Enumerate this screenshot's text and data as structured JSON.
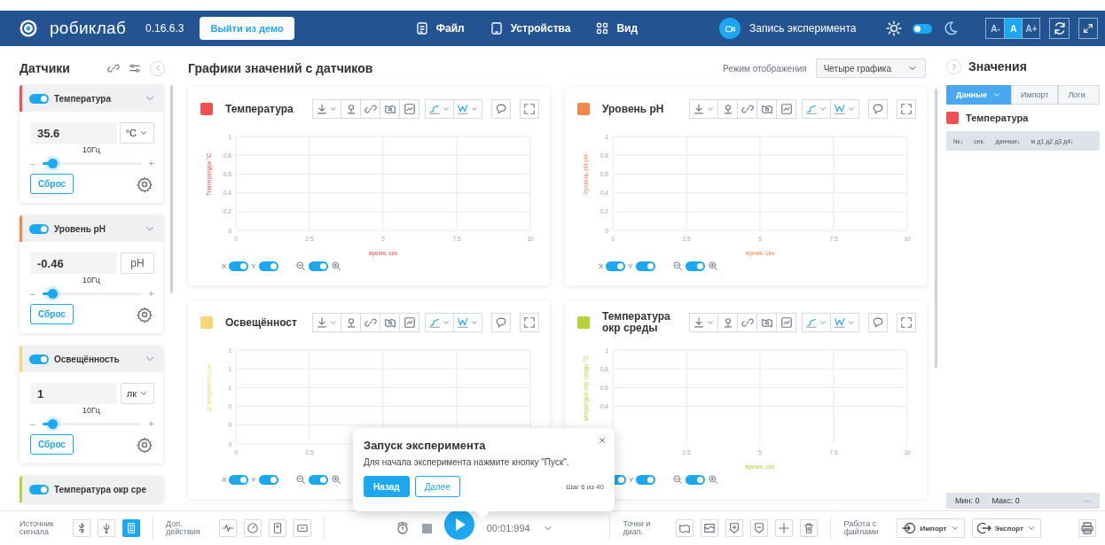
{
  "topbar": {
    "logo": "робиклаб",
    "version": "0.16.6.3",
    "demo_button": "Выйти из демо",
    "menu": [
      {
        "label": "Файл"
      },
      {
        "label": "Устройства"
      },
      {
        "label": "Вид"
      }
    ],
    "record": "Запись эксперимента",
    "dark_theme": false,
    "font_sizes": [
      {
        "label": "A-",
        "selected": false
      },
      {
        "label": "A",
        "selected": true
      },
      {
        "label": "A+",
        "selected": false
      }
    ]
  },
  "sidebar": {
    "title": "Датчики",
    "sensors": [
      {
        "kind": "full",
        "name": "Температура",
        "color": "#f05050",
        "enabled": true,
        "value": "35.6",
        "unit": "°C",
        "unit_dropdown": true,
        "rate": "10Гц",
        "minus": "–",
        "plus": "+",
        "level": 0.1,
        "reset": "Сброс"
      },
      {
        "kind": "full",
        "name": "Уровень pH",
        "color": "#f0884a",
        "enabled": true,
        "value": "-0.46",
        "unit": "pH",
        "unit_dropdown": false,
        "rate": "10Гц",
        "minus": "–",
        "plus": "+",
        "level": 0.1,
        "reset": "Сброс"
      },
      {
        "kind": "full",
        "name": "Освещённость",
        "color": "#f5d67a",
        "enabled": true,
        "value": "1",
        "unit": "лк",
        "unit_dropdown": true,
        "rate": "10Гц",
        "minus": "–",
        "plus": "+",
        "level": 0.1,
        "reset": "Сброс"
      },
      {
        "kind": "header",
        "name": "Температура окр сре",
        "color": "#b5d33a",
        "enabled": true
      }
    ]
  },
  "charts_panel": {
    "title": "Графики значений с датчиков",
    "mode_label": "Режим отображения",
    "mode_value": "Четыре графика",
    "charts": [
      {
        "title": "Температура",
        "color": "#f05050",
        "x_label": "X",
        "x_on": true,
        "y_label": "Y",
        "y_on": true,
        "zoom_on": true,
        "chart_data": {
          "type": "line",
          "grid": true,
          "xlabel": "время, сек",
          "ylabel": "Температура °C",
          "xlim": [
            0,
            10
          ],
          "ylim": [
            0,
            1
          ],
          "xticks": [
            0,
            2.5,
            5,
            7.5,
            10
          ],
          "yticks": [
            0,
            0.2,
            0.4,
            0.6,
            0.8,
            1
          ]
        }
      },
      {
        "title": "Уровень pH",
        "color": "#f0884a",
        "x_label": "X",
        "x_on": true,
        "y_label": "Y",
        "y_on": true,
        "zoom_on": true,
        "chart_data": {
          "type": "line",
          "grid": true,
          "xlabel": "время, сек",
          "ylabel": "Уровень pH pH",
          "xlim": [
            0,
            10
          ],
          "ylim": [
            0,
            1
          ],
          "xticks": [
            0,
            2.5,
            5,
            7.5,
            10
          ],
          "yticks": [
            0,
            0.2,
            0.4,
            0.6,
            0.8,
            1
          ]
        }
      },
      {
        "title": "Освещённост",
        "color": "#f5d67a",
        "x_label": "X",
        "x_on": true,
        "y_label": "Y",
        "y_on": true,
        "zoom_on": true,
        "chart_data": {
          "type": "line",
          "grid": true,
          "ylabel": "Освещённость лк",
          "xlim": [
            0,
            10
          ],
          "ylim": [
            0,
            1
          ],
          "xticks": [
            0,
            2.5
          ],
          "yticks": [
            0,
            {
              "value": 0.2,
              "label": "0"
            },
            {
              "value": 0.4,
              "label": "0"
            },
            {
              "value": 0.6,
              "label": "1"
            },
            {
              "value": 0.8,
              "label": "1"
            },
            1
          ]
        }
      },
      {
        "title": "Температура окр среды",
        "color": "#b5d33a",
        "x_on": true,
        "y_label": "Y",
        "y_on": true,
        "zoom_on": true,
        "chart_data": {
          "type": "line",
          "grid": true,
          "xlabel": "время, сек",
          "ylabel": "мпература окр среды °C",
          "xlim": [
            0,
            10
          ],
          "ylim": [
            0,
            1
          ],
          "xticks": [
            2.5,
            5,
            7.5,
            10
          ],
          "yticks": [
            0.4,
            0.6,
            0.8,
            1
          ]
        }
      }
    ]
  },
  "values_panel": {
    "title": "Значения",
    "tabs": [
      {
        "label": "Данные",
        "selected": true
      },
      {
        "label": "Импорт",
        "selected": false
      },
      {
        "label": "Логи",
        "selected": false
      }
    ],
    "sensor": {
      "name": "Температура",
      "color": "#f05050"
    },
    "columns": [
      "№↓",
      "сек.",
      "данные↓",
      "м д1 д2 д3 д4↓"
    ],
    "min": "Мин: 0",
    "max": "Макс: 0",
    "more": "···"
  },
  "popup": {
    "title": "Запуск эксперимента",
    "text": "Для начала эксперимента нажмите кнопку \"Пуск\".",
    "back": "Назад",
    "next": "Далее",
    "step": "Шаг 6 из 40"
  },
  "bottom_bar": {
    "source_label": "Источник сигнала",
    "sources": [
      {
        "selected": false
      },
      {
        "selected": false
      },
      {
        "selected": true
      }
    ],
    "actions_label": "Доп. действия",
    "time": "00:01:994",
    "points_label": "Точки и диап.",
    "files_label": "Работа с файлами",
    "import": "Импорт",
    "export": "Экспорт"
  }
}
